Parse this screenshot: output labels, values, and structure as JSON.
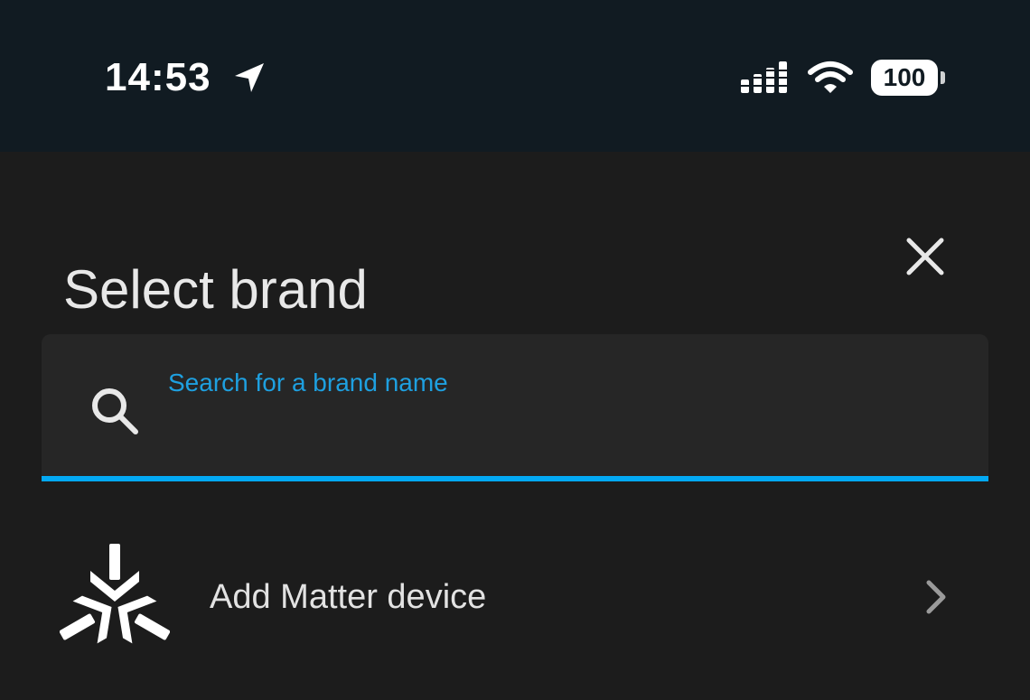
{
  "status_bar": {
    "time": "14:53",
    "battery_level": "100",
    "icons": [
      "location-arrow-icon",
      "signal-icon",
      "wifi-icon",
      "battery-icon"
    ]
  },
  "dialog": {
    "title": "Select brand",
    "close_icon": "close-icon"
  },
  "search": {
    "label": "Search for a brand name",
    "value": "",
    "icon": "search-icon"
  },
  "list": {
    "items": [
      {
        "label": "Add Matter device",
        "icon": "matter-logo-icon",
        "trailing_icon": "chevron-right-icon"
      }
    ]
  },
  "colors": {
    "status_bar_bg": "#111b22",
    "background": "#1c1c1c",
    "field_bg": "#262626",
    "accent": "#03a9f4",
    "text_primary": "#e8e8e8"
  }
}
